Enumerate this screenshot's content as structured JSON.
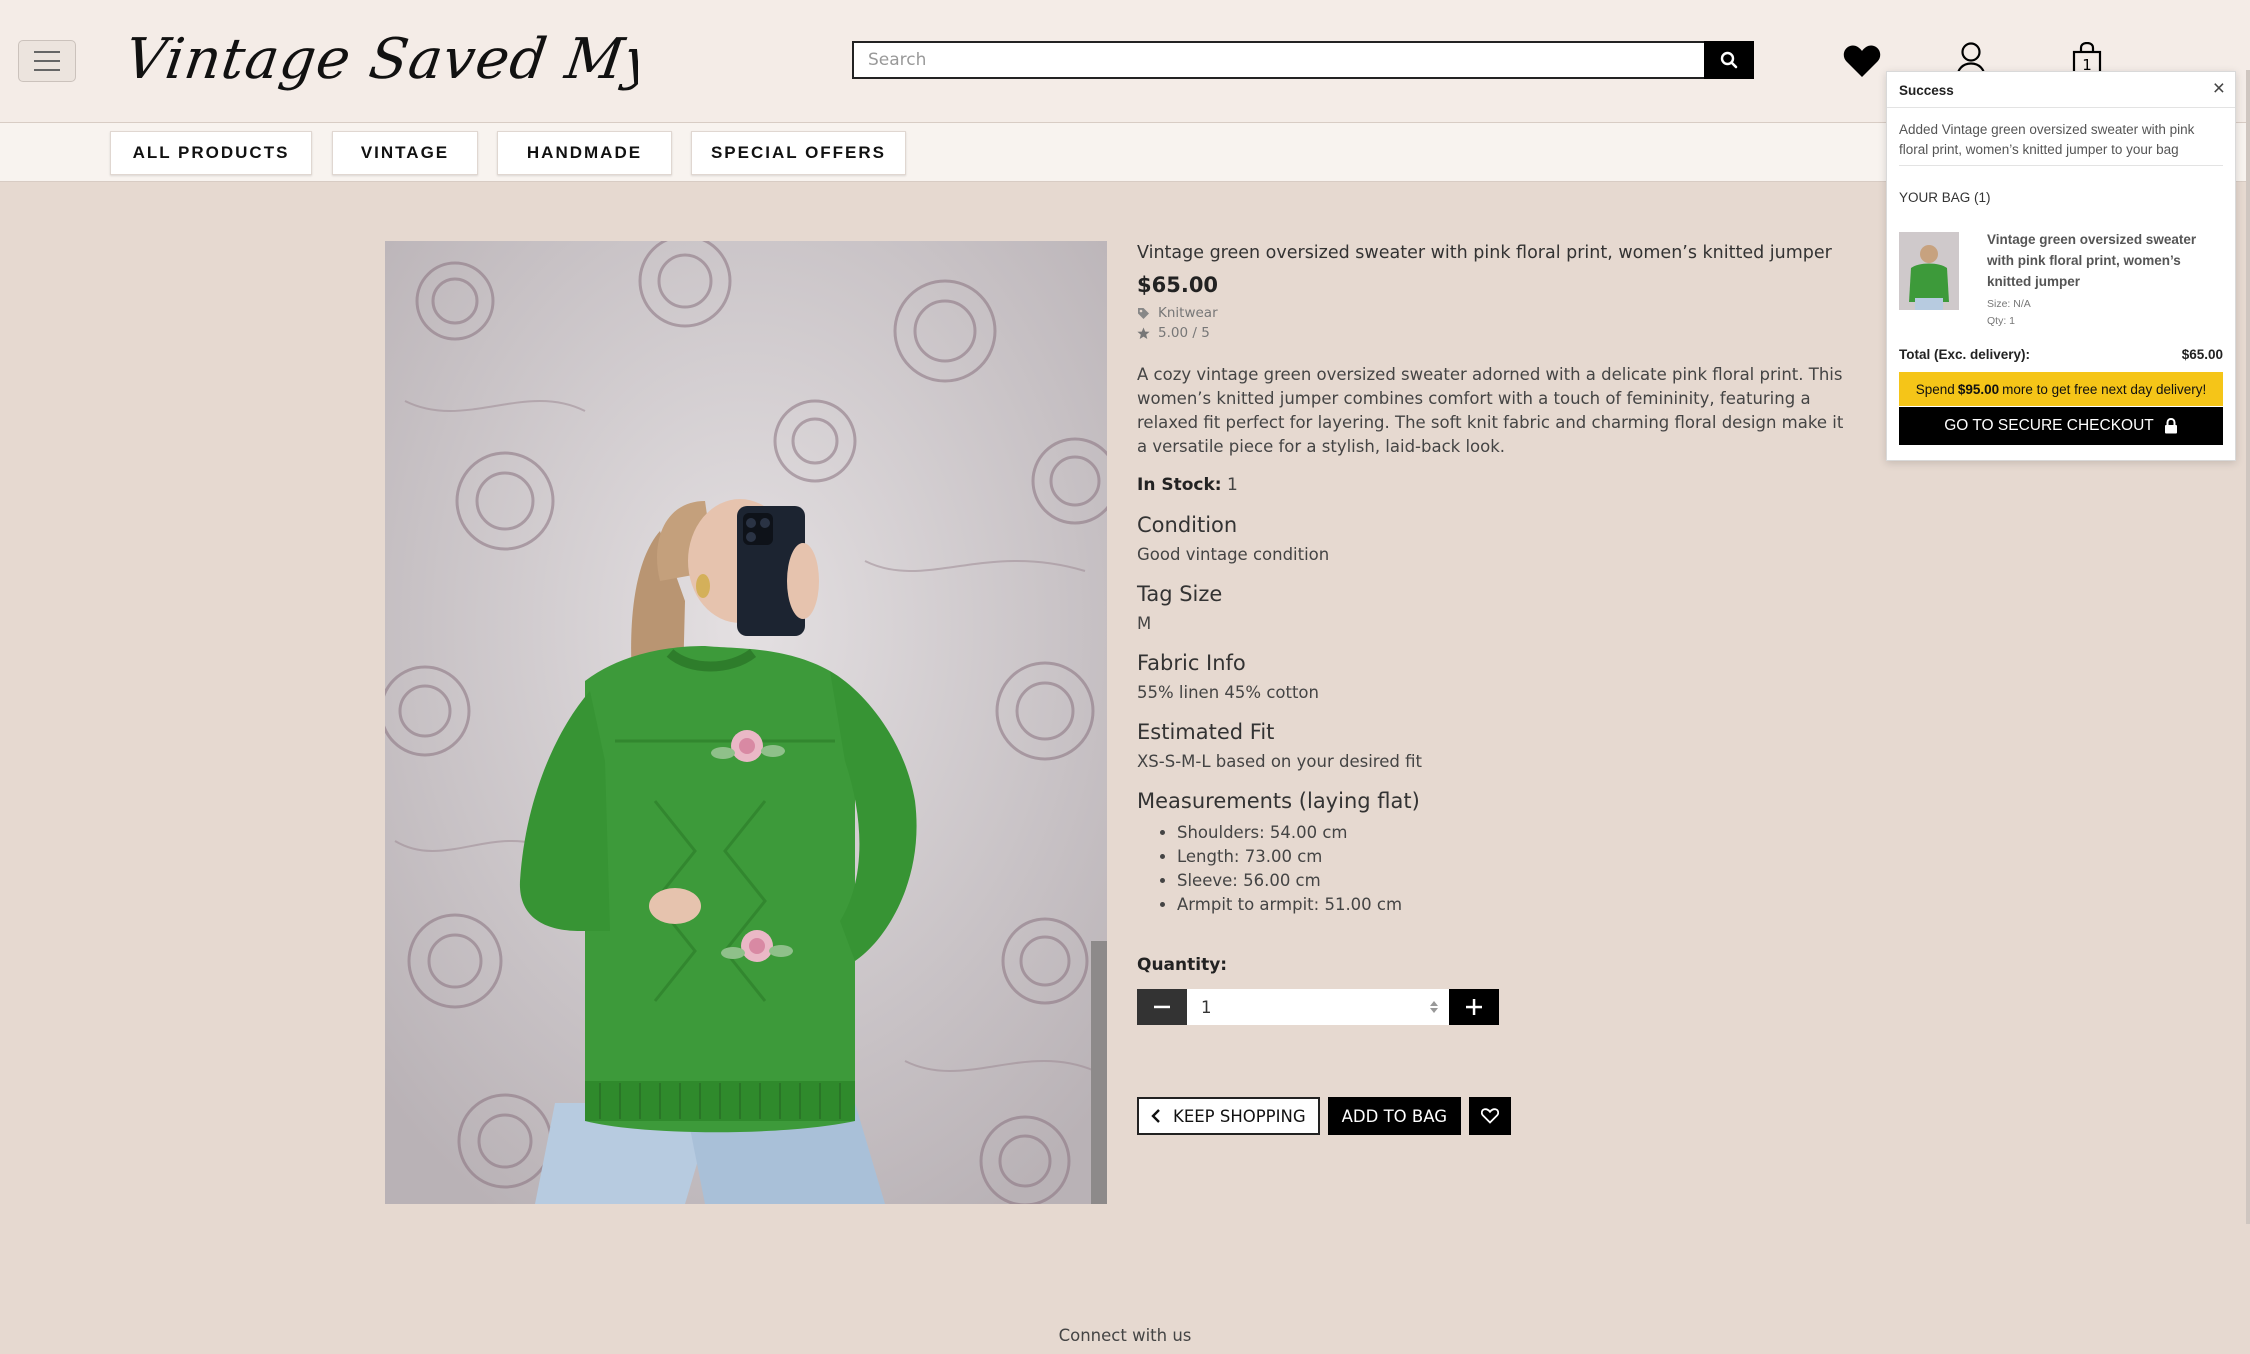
{
  "header": {
    "logo_text": "Vintage Saved My Soul",
    "search_placeholder": "Search",
    "bag_count": "1"
  },
  "nav": {
    "items": [
      "ALL PRODUCTS",
      "VINTAGE",
      "HANDMADE",
      "SPECIAL OFFERS"
    ]
  },
  "product": {
    "image_alt": "Vintage green oversized sweater with pink floral print, women's knitted jumper",
    "title": "Vintage green oversized sweater with pink floral print, women’s knitted jumper",
    "price": "$65.00",
    "category": "Knitwear",
    "rating": "5.00 / 5",
    "description": "A cozy vintage green oversized sweater adorned with a delicate pink floral print. This women’s knitted jumper combines comfort with a touch of femininity, featuring a relaxed fit perfect for layering. The soft knit fabric and charming floral design make it a versatile piece for a stylish, laid-back look.",
    "stock_label": "In Stock:",
    "stock_value": "1",
    "condition_heading": "Condition",
    "condition_value": "Good vintage condition",
    "tag_size_heading": "Tag Size",
    "tag_size_value": "M",
    "fabric_heading": "Fabric Info",
    "fabric_value": "55% linen 45% cotton",
    "fit_heading": "Estimated Fit",
    "fit_value": "XS-S-M-L based on your desired fit",
    "measurements_heading": "Measurements (laying flat)",
    "measurements": [
      "Shoulders: 54.00 cm",
      "Length: 73.00 cm",
      "Sleeve: 56.00 cm",
      "Armpit to armpit: 51.00 cm"
    ],
    "quantity_label": "Quantity:",
    "quantity_value": "1",
    "keep_shopping": "KEEP SHOPPING",
    "add_to_bag": "ADD TO BAG"
  },
  "footer": {
    "connect": "Connect with us"
  },
  "bag_popup": {
    "heading": "Success",
    "message": "Added Vintage green oversized sweater with pink floral print, women’s knitted jumper to your bag",
    "bag_heading": "YOUR BAG (1)",
    "item_title": "Vintage green oversized sweater with pink floral print, women’s knitted jumper",
    "item_size": "Size: N/A",
    "item_qty": "Qty: 1",
    "total_label": "Total (Exc. delivery):",
    "total_value": "$65.00",
    "promo_prefix": "Spend",
    "promo_amount": "$95.00",
    "promo_suffix": "more to get free next day delivery!",
    "checkout_label": "GO TO SECURE CHECKOUT"
  },
  "colors": {
    "page_bg": "#e6d9d0",
    "header_bg": "#f4ece7",
    "promo_yellow": "#f5c518",
    "sweater_green": "#3d9a3a"
  },
  "icons": [
    "menu-icon",
    "search-icon",
    "heart-icon",
    "user-icon",
    "bag-icon",
    "tag-icon",
    "star-icon",
    "minus-icon",
    "plus-icon",
    "chevron-left-icon",
    "heart-outline-icon",
    "close-icon",
    "lock-icon"
  ]
}
